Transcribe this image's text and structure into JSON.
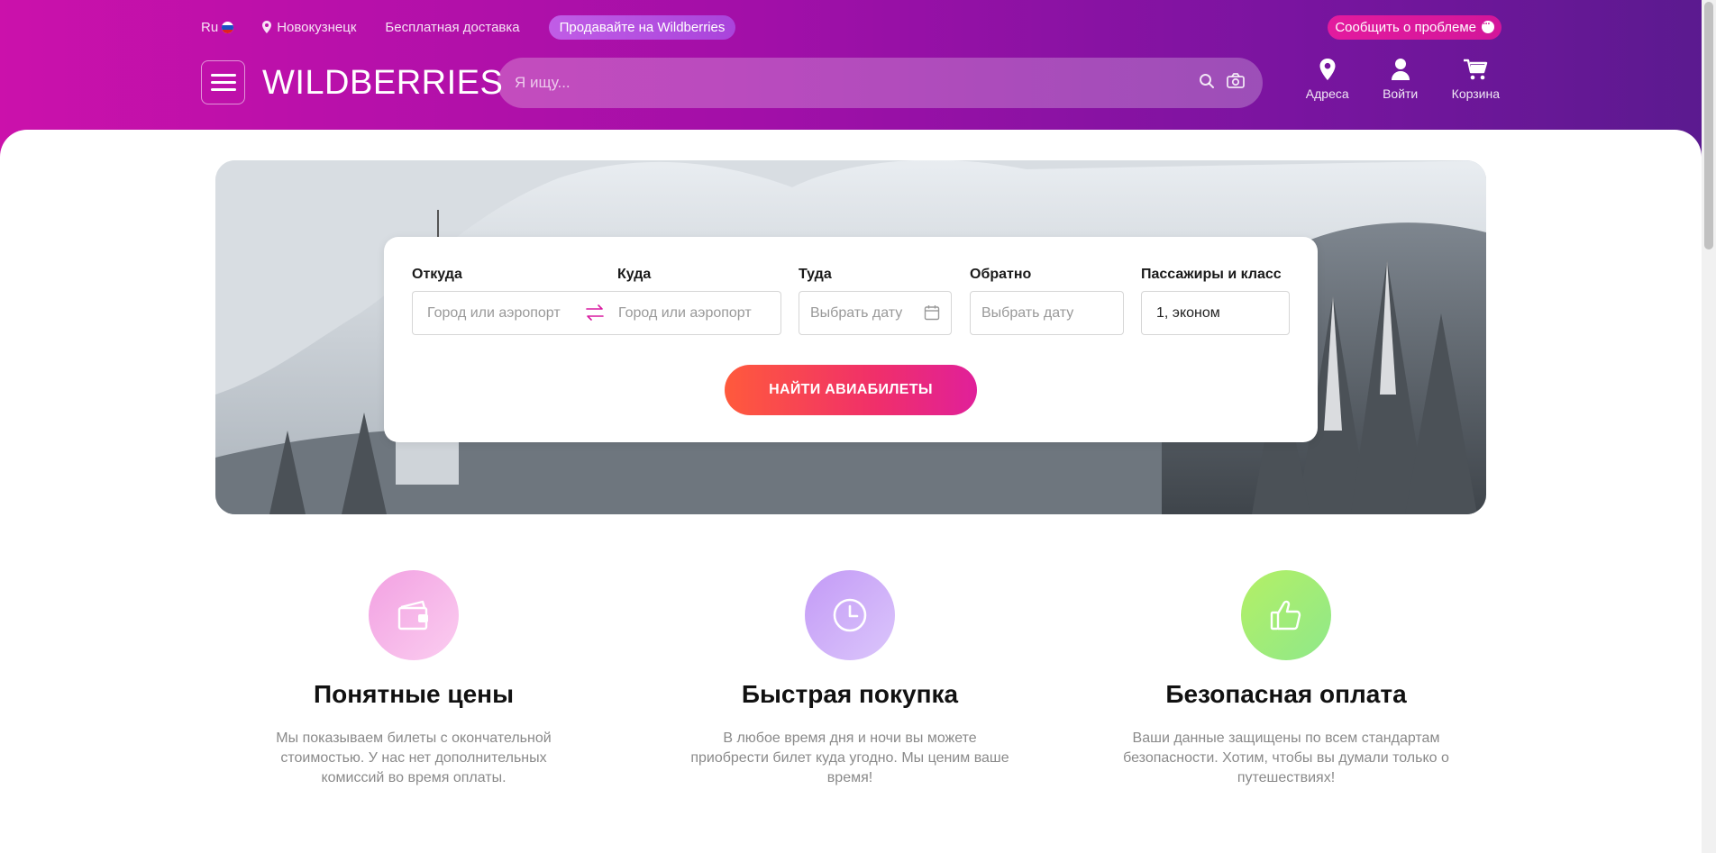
{
  "topbar": {
    "lang": "Ru",
    "city": "Новокузнецк",
    "delivery": "Бесплатная доставка",
    "sell_label": "Продавайте на Wildberries",
    "report_label": "Сообщить о проблеме"
  },
  "header": {
    "logo": "WILDBERRIES",
    "search_placeholder": "Я ищу...",
    "nav": {
      "addresses": "Адреса",
      "login": "Войти",
      "cart": "Корзина"
    }
  },
  "search_form": {
    "from": {
      "label": "Откуда",
      "placeholder": "Город или аэропорт"
    },
    "to": {
      "label": "Куда",
      "placeholder": "Город или аэропорт"
    },
    "depart": {
      "label": "Туда",
      "placeholder": "Выбрать дату"
    },
    "return": {
      "label": "Обратно",
      "placeholder": "Выбрать дату"
    },
    "passengers": {
      "label": "Пассажиры и класс",
      "value": "1, эконом"
    },
    "submit_label": "НАЙТИ АВИАБИЛЕТЫ"
  },
  "features": [
    {
      "title": "Понятные цены",
      "text": "Мы показываем билеты с окончательной стоимостью. У нас нет дополнительных комиссий во время оплаты.",
      "icon": "wallet-icon",
      "color": "#f5a8e6"
    },
    {
      "title": "Быстрая покупка",
      "text": "В любое время дня и ночи вы можете приобрести билет куда угодно. Мы ценим ваше время!",
      "icon": "clock-icon",
      "color": "#c9a8f8"
    },
    {
      "title": "Безопасная оплата",
      "text": "Ваши данные защищены по всем стандартам безопасности. Хотим, чтобы вы думали только о путешествиях!",
      "icon": "thumbs-up-icon",
      "color": "#a6ee72"
    }
  ]
}
